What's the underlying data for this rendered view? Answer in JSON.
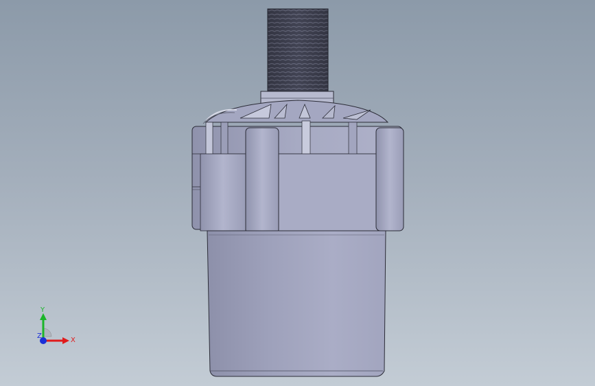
{
  "viewport": {
    "background_top": "#8c9aa9",
    "background_bottom": "#c3ccd5",
    "part_color": "#a6a9c3",
    "edge_color": "#2a2b36"
  },
  "model": {
    "name": "pump-motor-assembly",
    "components": [
      "threaded-shaft",
      "shaft-collar",
      "impeller-fins",
      "housing-flange",
      "motor-body"
    ]
  },
  "triad": {
    "x_label": "X",
    "y_label": "Y",
    "z_label": "Z",
    "x_color": "#e01b1b",
    "y_color": "#1bb52a",
    "z_color": "#1a2fd8"
  }
}
